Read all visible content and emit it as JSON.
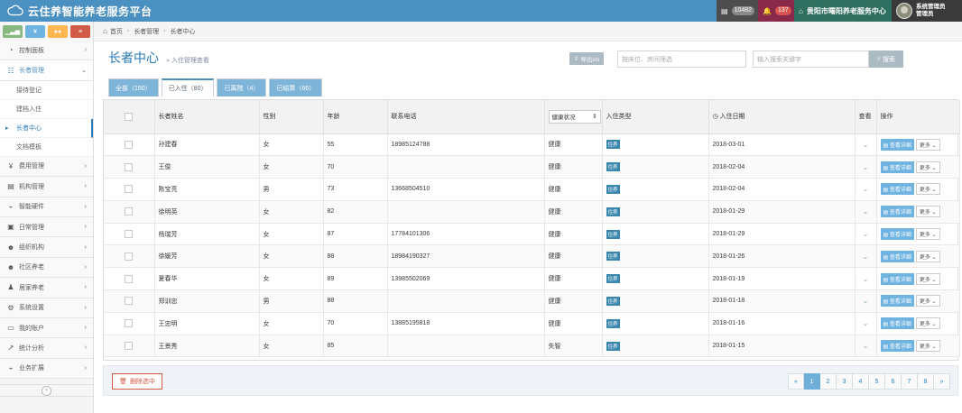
{
  "app": {
    "title": "云住养智能养老服务平台"
  },
  "topbar": {
    "messages_count": "10482",
    "notices_count": "137",
    "org_name": "贵阳市曙阳养老服务中心",
    "user_line1": "系统管理员",
    "user_line2": "管理员"
  },
  "sidebar": {
    "shortcuts": [
      "📊",
      "¥",
      "👥",
      "☰"
    ],
    "items": [
      {
        "label": "控制面板",
        "icon": "dashboard-icon",
        "glyph": "◔"
      },
      {
        "label": "长者管理",
        "icon": "list-icon",
        "glyph": "☷"
      },
      {
        "label": "费用管理",
        "icon": "yen-icon",
        "glyph": "¥"
      },
      {
        "label": "机构管理",
        "icon": "building-icon",
        "glyph": "▤"
      },
      {
        "label": "智能硬件",
        "icon": "usb-icon",
        "glyph": "⌁"
      },
      {
        "label": "日常管理",
        "icon": "id-card-icon",
        "glyph": "▣"
      },
      {
        "label": "组织机构",
        "icon": "users-icon",
        "glyph": "👥"
      },
      {
        "label": "社区养老",
        "icon": "group-icon",
        "glyph": "👥"
      },
      {
        "label": "居家养老",
        "icon": "user-icon",
        "glyph": "♟"
      },
      {
        "label": "系统设置",
        "icon": "cogs-icon",
        "glyph": "⚙"
      },
      {
        "label": "我的账户",
        "icon": "credit-card-icon",
        "glyph": "▭"
      },
      {
        "label": "统计分析",
        "icon": "chart-icon",
        "glyph": "📈"
      },
      {
        "label": "业务扩展",
        "icon": "usb-icon",
        "glyph": "⌁"
      }
    ],
    "subitems": [
      "接待登记",
      "建档入住",
      "长者中心",
      "文档模板"
    ]
  },
  "breadcrumb": {
    "home": "首页",
    "level1": "长者管理",
    "level2": "长者中心"
  },
  "page": {
    "title": "长者中心",
    "subtitle": "» 入住管理查看"
  },
  "toolbar": {
    "export_label": "导出xls",
    "bed_placeholder": "按床位、房间筛选",
    "keyword_placeholder": "输入搜索关键字",
    "search_label": "搜索"
  },
  "tabs": [
    {
      "label": "全部（150）"
    },
    {
      "label": "已入住（80）"
    },
    {
      "label": "已离院（4）"
    },
    {
      "label": "已结算（66）"
    }
  ],
  "table": {
    "headers": {
      "name": "长者姓名",
      "gender": "性别",
      "age": "年龄",
      "phone": "联系电话",
      "health": "健康状况",
      "type": "入住类型",
      "date": "入住日期",
      "view": "查看",
      "ops": "操作"
    },
    "detail_label": "查看详细",
    "more_label": "更多",
    "rows": [
      {
        "name": "孙建春",
        "gender": "女",
        "age": "55",
        "phone": "18985124788",
        "health": "健康",
        "type": "住养",
        "date": "2018-03-01"
      },
      {
        "name": "王俊",
        "gender": "女",
        "age": "70",
        "phone": "",
        "health": "健康",
        "type": "住养",
        "date": "2018-02-04"
      },
      {
        "name": "陈宝亮",
        "gender": "男",
        "age": "73",
        "phone": "13668504510",
        "health": "健康",
        "type": "住养",
        "date": "2018-02-04"
      },
      {
        "name": "徐明英",
        "gender": "女",
        "age": "82",
        "phone": "",
        "health": "健康",
        "type": "住养",
        "date": "2018-01-29"
      },
      {
        "name": "杨瑞芳",
        "gender": "女",
        "age": "87",
        "phone": "17784101306",
        "health": "健康",
        "type": "住养",
        "date": "2018-01-29"
      },
      {
        "name": "徐媛芳",
        "gender": "女",
        "age": "88",
        "phone": "18984190327",
        "health": "健康",
        "type": "住养",
        "date": "2018-01-26"
      },
      {
        "name": "夏春华",
        "gender": "女",
        "age": "89",
        "phone": "13985502069",
        "health": "健康",
        "type": "住养",
        "date": "2018-01-19"
      },
      {
        "name": "郑训忠",
        "gender": "男",
        "age": "88",
        "phone": "",
        "health": "健康",
        "type": "住养",
        "date": "2018-01-18"
      },
      {
        "name": "王忠明",
        "gender": "女",
        "age": "70",
        "phone": "13885195818",
        "health": "健康",
        "type": "住养",
        "date": "2018-01-16"
      },
      {
        "name": "王景秀",
        "gender": "女",
        "age": "85",
        "phone": "",
        "health": "失智",
        "type": "住养",
        "date": "2018-01-15"
      }
    ]
  },
  "footer": {
    "delete_label": "删除选中",
    "pages": [
      "«",
      "1",
      "2",
      "3",
      "4",
      "5",
      "6",
      "7",
      "8",
      "»"
    ],
    "current_page": "1"
  }
}
